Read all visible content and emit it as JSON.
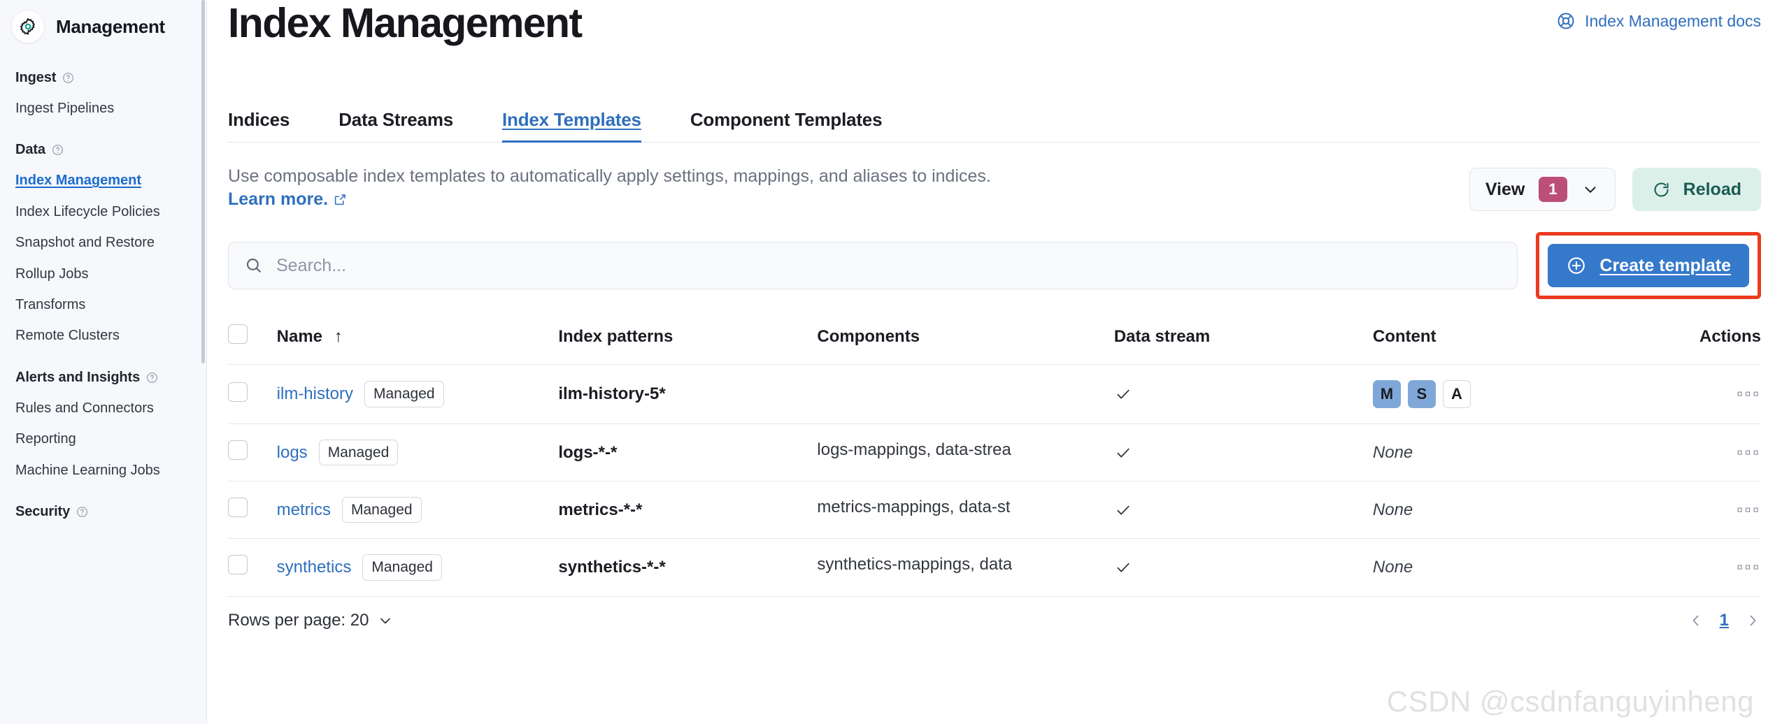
{
  "sidebar": {
    "title": "Management",
    "logo_icon": "gear-icon",
    "groups": [
      {
        "title": "Ingest",
        "help_icon": "question-circle-icon",
        "items": [
          {
            "label": "Ingest Pipelines",
            "active": false
          }
        ]
      },
      {
        "title": "Data",
        "help_icon": "question-circle-icon",
        "items": [
          {
            "label": "Index Management",
            "active": true
          },
          {
            "label": "Index Lifecycle Policies",
            "active": false
          },
          {
            "label": "Snapshot and Restore",
            "active": false
          },
          {
            "label": "Rollup Jobs",
            "active": false
          },
          {
            "label": "Transforms",
            "active": false
          },
          {
            "label": "Remote Clusters",
            "active": false
          }
        ]
      },
      {
        "title": "Alerts and Insights",
        "help_icon": "question-circle-icon",
        "items": [
          {
            "label": "Rules and Connectors",
            "active": false
          },
          {
            "label": "Reporting",
            "active": false
          },
          {
            "label": "Machine Learning Jobs",
            "active": false
          }
        ]
      },
      {
        "title": "Security",
        "help_icon": "question-circle-icon",
        "items": []
      }
    ]
  },
  "header": {
    "title": "Index Management",
    "docs_link": "Index Management docs",
    "docs_icon": "life-ring-icon"
  },
  "tabs": [
    {
      "label": "Indices",
      "active": false
    },
    {
      "label": "Data Streams",
      "active": false
    },
    {
      "label": "Index Templates",
      "active": true
    },
    {
      "label": "Component Templates",
      "active": false
    }
  ],
  "description": {
    "text": "Use composable index templates to automatically apply settings, mappings, and aliases to indices.",
    "learn_more": "Learn more.",
    "external_icon": "external-link-icon"
  },
  "toolbar": {
    "view_label": "View",
    "view_count": "1",
    "view_chevron_icon": "chevron-down-icon",
    "reload_label": "Reload",
    "reload_icon": "refresh-icon"
  },
  "search": {
    "placeholder": "Search...",
    "value": "",
    "icon": "search-icon"
  },
  "create_button": {
    "label": "Create template",
    "icon": "plus-circle-icon",
    "highlight_color": "#ec3b20",
    "background_color": "#3579cb"
  },
  "table": {
    "columns": [
      {
        "key": "checkbox",
        "label": ""
      },
      {
        "key": "name",
        "label": "Name",
        "sort_icon": "arrow-up-icon"
      },
      {
        "key": "patterns",
        "label": "Index patterns"
      },
      {
        "key": "components",
        "label": "Components"
      },
      {
        "key": "datastream",
        "label": "Data stream"
      },
      {
        "key": "content",
        "label": "Content"
      },
      {
        "key": "actions",
        "label": "Actions"
      }
    ],
    "rows": [
      {
        "name": "ilm-history",
        "badge": "Managed",
        "patterns": "ilm-history-5*",
        "components": "",
        "data_stream": "check-icon",
        "content_type": "badges",
        "content_badges": [
          {
            "letter": "M",
            "filled": true
          },
          {
            "letter": "S",
            "filled": true
          },
          {
            "letter": "A",
            "filled": false
          }
        ],
        "actions_icon": "ellipsis-icon"
      },
      {
        "name": "logs",
        "badge": "Managed",
        "patterns": "logs-*-*",
        "components": "logs-mappings, data-strea",
        "data_stream": "check-icon",
        "content_type": "none",
        "content_text": "None",
        "actions_icon": "ellipsis-icon"
      },
      {
        "name": "metrics",
        "badge": "Managed",
        "patterns": "metrics-*-*",
        "components": "metrics-mappings, data-st",
        "data_stream": "check-icon",
        "content_type": "none",
        "content_text": "None",
        "actions_icon": "ellipsis-icon"
      },
      {
        "name": "synthetics",
        "badge": "Managed",
        "patterns": "synthetics-*-*",
        "components": "synthetics-mappings, data",
        "data_stream": "check-icon",
        "content_type": "none",
        "content_text": "None",
        "actions_icon": "ellipsis-icon"
      }
    ]
  },
  "footer": {
    "rows_per_page": "Rows per page: 20",
    "rows_chevron_icon": "chevron-down-icon",
    "prev_icon": "chevron-left-icon",
    "next_icon": "chevron-right-icon",
    "current_page": "1"
  },
  "watermark": "CSDN @csdnfanguyinheng"
}
